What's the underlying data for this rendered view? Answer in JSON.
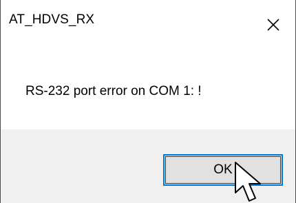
{
  "window": {
    "title": "AT_HDVS_RX",
    "close_icon": "close-x-icon"
  },
  "dialog": {
    "message": "RS-232 port error on COM 1: !",
    "ok_label": "OK"
  },
  "cursor": {
    "icon": "arrow-pointer-icon"
  },
  "colors": {
    "accent": "#0078d7",
    "footer_bg": "#f0f0f0",
    "button_bg": "#e1e1e1"
  }
}
